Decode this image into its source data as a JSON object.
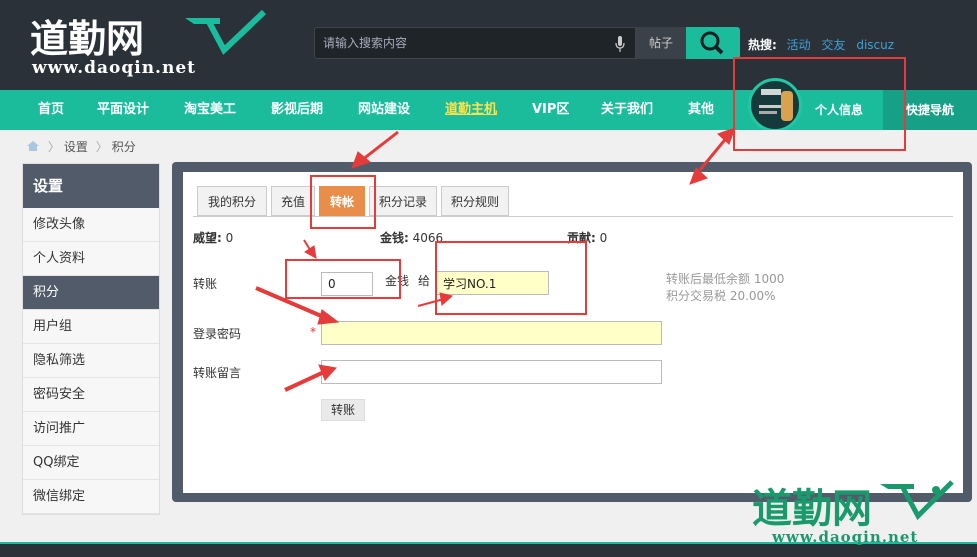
{
  "header": {
    "logo_text": "道勤网",
    "logo_url": "www.daoqin.net",
    "search_placeholder": "请输入搜索内容",
    "search_type": "帖子",
    "hot_label": "热搜:",
    "hot_links": [
      "活动",
      "交友",
      "discuz"
    ]
  },
  "nav": {
    "items": [
      "首页",
      "平面设计",
      "淘宝美工",
      "影视后期",
      "网站建设",
      "道勤主机",
      "VIP区",
      "关于我们",
      "其他"
    ],
    "active": "道勤主机",
    "profile_label": "个人信息",
    "quick_nav": "快捷导航"
  },
  "breadcrumb": [
    "设置",
    "积分"
  ],
  "sidebar": {
    "title": "设置",
    "items": [
      "修改头像",
      "个人资料",
      "积分",
      "用户组",
      "隐私筛选",
      "密码安全",
      "访问推广",
      "QQ绑定",
      "微信绑定"
    ],
    "active": "积分"
  },
  "tabs": {
    "items": [
      "我的积分",
      "充值",
      "转帐",
      "积分记录",
      "积分规则"
    ],
    "active": "转帐"
  },
  "stats": {
    "prestige_label": "威望:",
    "prestige_value": "0",
    "money_label": "金钱:",
    "money_value": "4066",
    "contribution_label": "贡献:",
    "contribution_value": "0"
  },
  "form": {
    "transfer_label": "转账",
    "amount_value": "0",
    "currency_label": "金钱",
    "to_label": "给",
    "recipient_value": "学习NO.1",
    "password_label": "登录密码",
    "required_mark": "*",
    "message_label": "转账留言",
    "submit_label": "转账",
    "hint_min_balance": "转账后最低余额 1000",
    "hint_tax": "积分交易税 20.00%"
  },
  "watermark": {
    "text": "道勤网",
    "url": "www.daoqin.net"
  },
  "colors": {
    "accent": "#1abc9c",
    "dark_bg": "#2b3138",
    "panel": "#515b69",
    "active_tab": "#e98e4a",
    "annotation": "#e53b3b"
  }
}
